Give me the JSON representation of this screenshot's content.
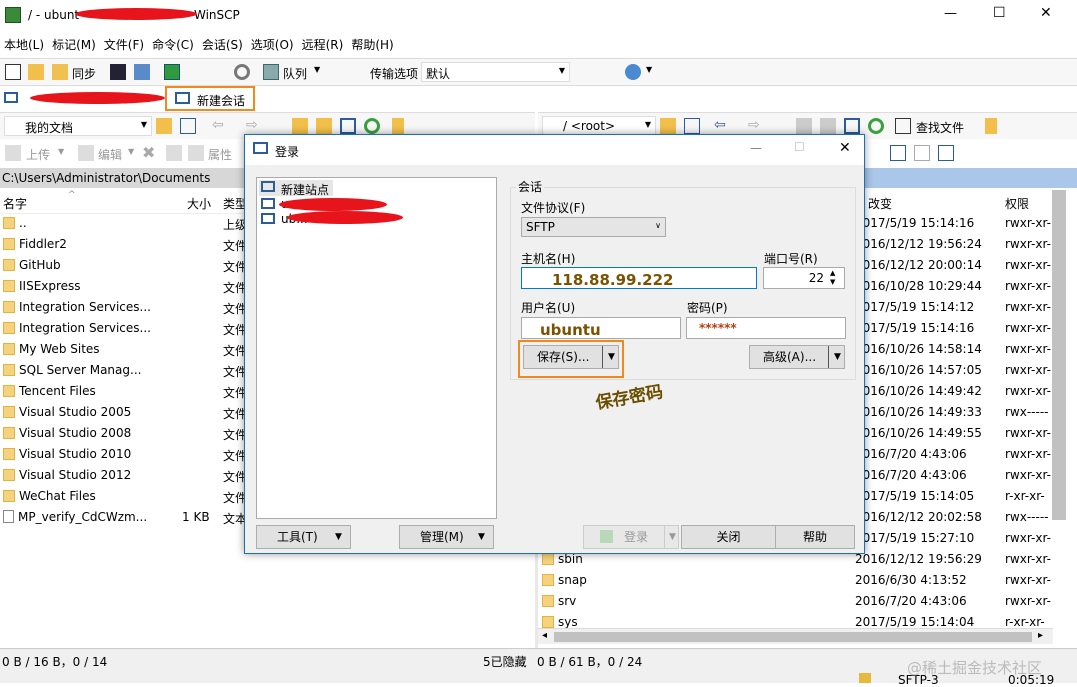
{
  "app": {
    "title_prefix": "/ - ubunt",
    "title_suffix": "WinSCP"
  },
  "window_controls": {
    "minimize": "—",
    "maximize": "☐",
    "close": "✕"
  },
  "menu": [
    "本地(L)",
    "标记(M)",
    "文件(F)",
    "命令(C)",
    "会话(S)",
    "选项(O)",
    "远程(R)",
    "帮助(H)"
  ],
  "toolbar": {
    "sync": "同步",
    "queue": "队列",
    "transfer_label": "传输选项",
    "transfer_value": "默认"
  },
  "session_tab": {
    "new_session": "新建会话"
  },
  "local": {
    "drive": "我的文档",
    "upload": "上传",
    "edit": "编辑",
    "props": "属性",
    "path": "C:\\Users\\Administrator\\Documents",
    "cols": {
      "name": "名字",
      "size": "大小",
      "type": "类型"
    },
    "rows": [
      {
        "name": "..",
        "size": "",
        "type": "上级",
        "kind": "up"
      },
      {
        "name": "Fiddler2",
        "size": "",
        "type": "文件",
        "kind": "folder"
      },
      {
        "name": "GitHub",
        "size": "",
        "type": "文件",
        "kind": "folder"
      },
      {
        "name": "IISExpress",
        "size": "",
        "type": "文件",
        "kind": "folder"
      },
      {
        "name": "Integration Services...",
        "size": "",
        "type": "文件",
        "kind": "folder"
      },
      {
        "name": "Integration Services...",
        "size": "",
        "type": "文件",
        "kind": "folder"
      },
      {
        "name": "My Web Sites",
        "size": "",
        "type": "文件",
        "kind": "folder"
      },
      {
        "name": "SQL Server Manag...",
        "size": "",
        "type": "文件",
        "kind": "folder"
      },
      {
        "name": "Tencent Files",
        "size": "",
        "type": "文件",
        "kind": "folder"
      },
      {
        "name": "Visual Studio 2005",
        "size": "",
        "type": "文件",
        "kind": "folder"
      },
      {
        "name": "Visual Studio 2008",
        "size": "",
        "type": "文件",
        "kind": "folder"
      },
      {
        "name": "Visual Studio 2010",
        "size": "",
        "type": "文件",
        "kind": "folder"
      },
      {
        "name": "Visual Studio 2012",
        "size": "",
        "type": "文件",
        "kind": "folder"
      },
      {
        "name": "WeChat Files",
        "size": "",
        "type": "文件",
        "kind": "folder"
      },
      {
        "name": "MP_verify_CdCWzm...",
        "size": "1 KB",
        "type": "文本",
        "kind": "file"
      }
    ],
    "status": "0 B / 16 B，0 / 14"
  },
  "remote": {
    "root": "/ <root>",
    "find": "查找文件",
    "cols": {
      "changed": "改变",
      "rights": "权限"
    },
    "rows": [
      {
        "date": "2017/5/19 15:14:16",
        "rights": "rwxr-xr-"
      },
      {
        "date": "2016/12/12 19:56:24",
        "rights": "rwxr-xr-"
      },
      {
        "date": "2016/12/12 20:00:14",
        "rights": "rwxr-xr-"
      },
      {
        "date": "2016/10/28 10:29:44",
        "rights": "rwxr-xr-"
      },
      {
        "date": "2017/5/19 15:14:12",
        "rights": "rwxr-xr-"
      },
      {
        "date": "2017/5/19 15:14:16",
        "rights": "rwxr-xr-"
      },
      {
        "date": "2016/10/26 14:58:14",
        "rights": "rwxr-xr-"
      },
      {
        "date": "2016/10/26 14:57:05",
        "rights": "rwxr-xr-"
      },
      {
        "date": "2016/10/26 14:49:42",
        "rights": "rwxr-xr-"
      },
      {
        "date": "2016/10/26 14:49:33",
        "rights": "rwx-----"
      },
      {
        "date": "2016/10/26 14:49:55",
        "rights": "rwxr-xr-"
      },
      {
        "date": "2016/7/20 4:43:06",
        "rights": "rwxr-xr-"
      },
      {
        "date": "2016/7/20 4:43:06",
        "rights": "rwxr-xr-"
      },
      {
        "date": "2017/5/19 15:14:05",
        "rights": "r-xr-xr-"
      },
      {
        "date": "2016/12/12 20:02:58",
        "rights": "rwx-----"
      },
      {
        "date": "2017/5/19 15:27:10",
        "rights": "rwxr-xr-"
      }
    ],
    "bottom_rows": [
      {
        "name": "sbin",
        "date": "2016/12/12 19:56:29",
        "rights": "rwxr-xr-"
      },
      {
        "name": "snap",
        "date": "2016/6/30 4:13:52",
        "rights": "rwxr-xr-"
      },
      {
        "name": "srv",
        "date": "2016/7/20 4:43:06",
        "rights": "rwxr-xr-"
      },
      {
        "name": "sys",
        "date": "2017/5/19 15:14:04",
        "rights": "r-xr-xr-"
      }
    ],
    "hidden": "5已隐藏",
    "status": "0 B / 61 B，0 / 24"
  },
  "statusbar": {
    "protocol": "SFTP-3",
    "time": "0:05:19",
    "watermark": "@稀土掘金技术社区"
  },
  "dialog": {
    "title": "登录",
    "sites": [
      "新建站点",
      "u...",
      "ub..."
    ],
    "session_group": "会话",
    "protocol_label": "文件协议(F)",
    "protocol_value": "SFTP",
    "host_label": "主机名(H)",
    "host_value": "118.88.99.222",
    "port_label": "端口号(R)",
    "port_value": "22",
    "user_label": "用户名(U)",
    "user_value": "ubuntu",
    "pass_label": "密码(P)",
    "pass_value": "******",
    "save": "保存(S)...",
    "advanced": "高级(A)...",
    "annotation": "保存密码",
    "tools": "工具(T)",
    "manage": "管理(M)",
    "login": "登录",
    "close": "关闭",
    "help": "帮助"
  }
}
